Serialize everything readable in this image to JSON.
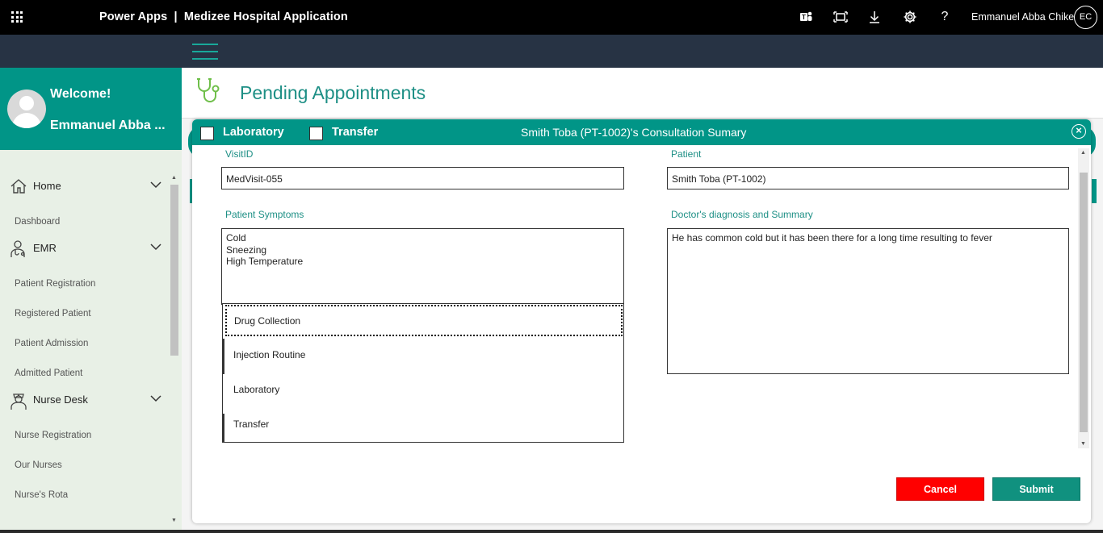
{
  "topbar": {
    "title": "Power Apps  |  Medizee Hospital Application",
    "username": "Emmanuel Abba Chike",
    "initials": "EC",
    "icons": [
      "app-launcher-icon",
      "teams-icon",
      "fit-screen-icon",
      "download-icon",
      "settings-icon",
      "help-icon"
    ]
  },
  "sidebar": {
    "welcome": "Welcome!",
    "user_name": "Emmanuel Abba ...",
    "sections": [
      {
        "label": "Home",
        "icon": "home-icon",
        "items": [
          "Dashboard"
        ]
      },
      {
        "label": "EMR",
        "icon": "doctor-icon",
        "items": [
          "Patient Registration",
          "Registered Patient",
          "Patient Admission",
          "Admitted Patient"
        ]
      },
      {
        "label": "Nurse Desk",
        "icon": "nurse-icon",
        "items": [
          "Nurse Registration",
          "Our Nurses",
          "Nurse's Rota"
        ]
      }
    ]
  },
  "page": {
    "title": "Pending Appointments",
    "icon": "stethoscope-icon"
  },
  "dialog": {
    "checkbox_1": "Laboratory",
    "checkbox_2": "Transfer",
    "title": "Smith Toba (PT-1002)'s Consultation Sumary",
    "visit_label": "VisitID",
    "visit_value": "MedVisit-055",
    "patient_label": "Patient",
    "patient_value": "Smith Toba (PT-1002)",
    "symptoms_label": "Patient Symptoms",
    "symptoms_value": "Cold\nSneezing\nHigh Temperature",
    "diagnosis_label": "Doctor's diagnosis and Summary",
    "diagnosis_value": "He has common cold but it has been there for a long time resulting to fever",
    "dropdown_options": [
      "Drug Collection",
      "Injection Routine",
      "Laboratory",
      "Transfer"
    ],
    "cancel_label": "Cancel",
    "submit_label": "Submit"
  },
  "colors": {
    "teal": "#019587",
    "navy": "#273344",
    "cancel_red": "#ff0000",
    "submit_green": "#10917f"
  }
}
